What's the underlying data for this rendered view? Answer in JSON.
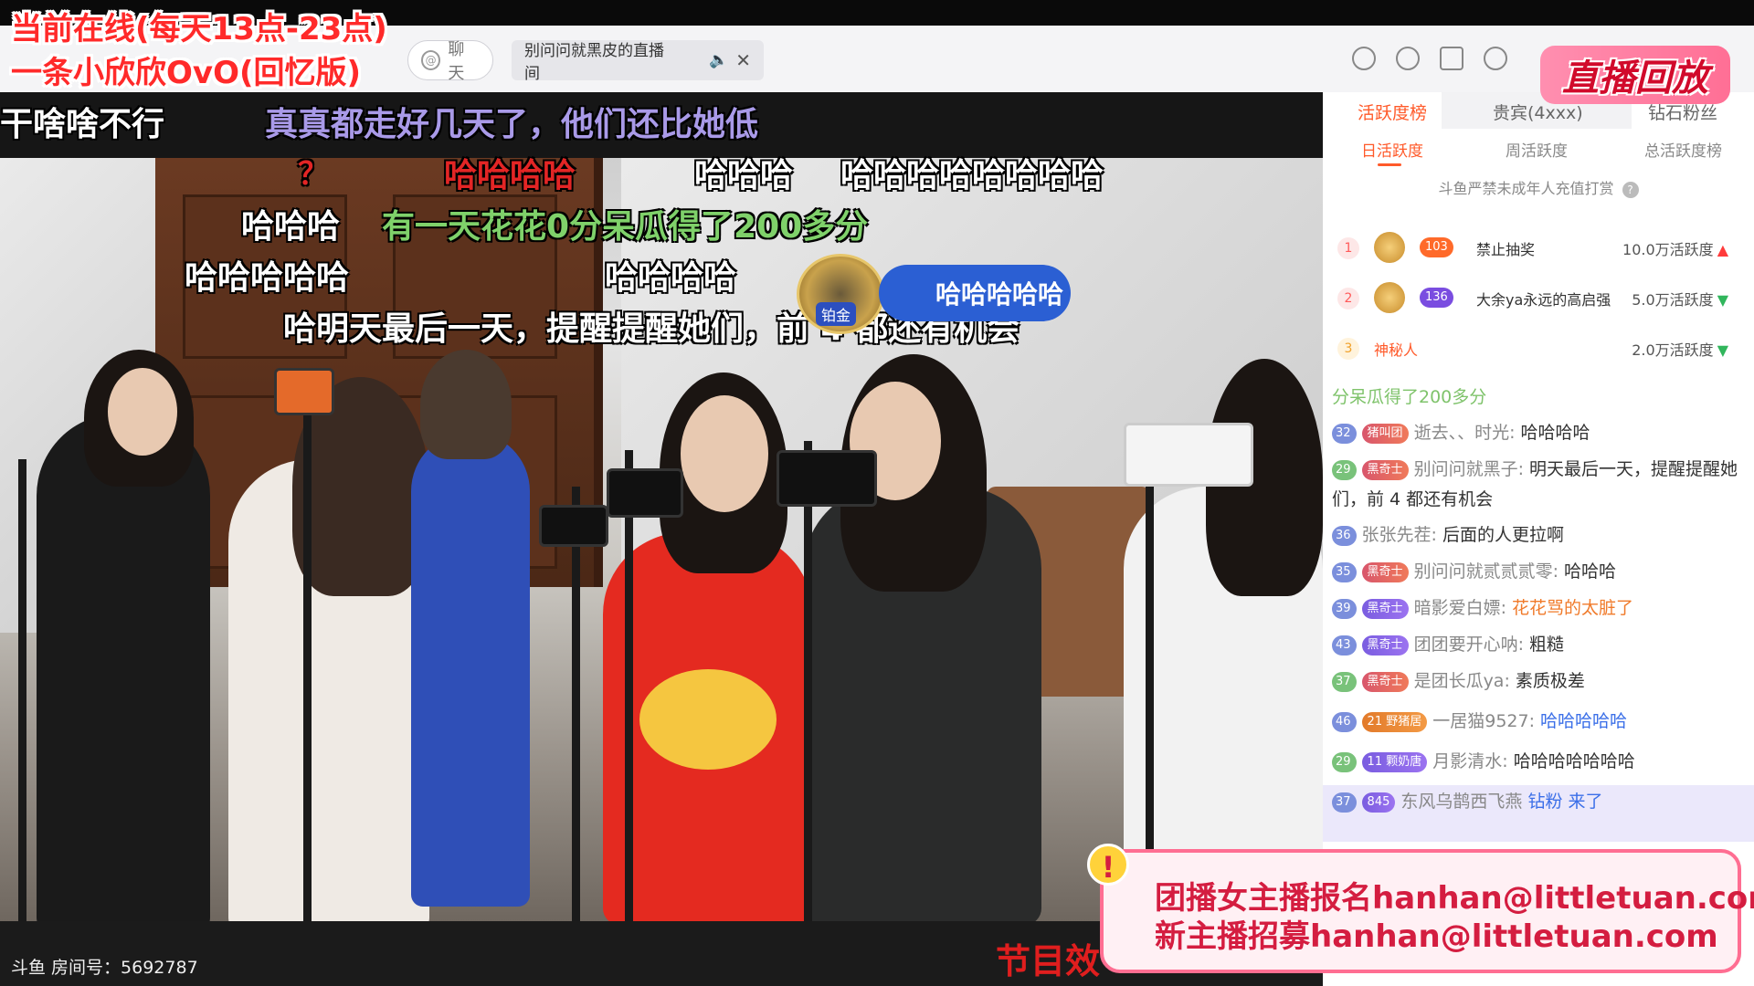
{
  "overlay": {
    "title_line1": "当前在线(每天13点-23点)",
    "title_line2": "一条小欣欣OvO(回忆版)"
  },
  "tabs": {
    "chat_label": "聊天",
    "room_label": "别问问就黑皮的直播间"
  },
  "replay_badge": "直播回放",
  "danmaku": [
    {
      "text": "干啥啥不行",
      "color": "white"
    },
    {
      "text": "真真都走好几天了，他们还比她低",
      "color": "mixed"
    },
    {
      "text": "？",
      "color": "red"
    },
    {
      "text": "哈哈哈哈",
      "color": "red"
    },
    {
      "text": "哈哈哈",
      "color": "white"
    },
    {
      "text": "哈哈哈哈哈哈哈哈",
      "color": "white"
    },
    {
      "text": "哈哈哈",
      "color": "white"
    },
    {
      "text": "有一天花花0分呆瓜得了200多分",
      "color": "green"
    },
    {
      "text": "哈哈哈哈哈",
      "color": "white"
    },
    {
      "text": "哈哈哈哈",
      "color": "white"
    },
    {
      "text": "哈明天最后一天，提醒提醒她们，前 4 都还有机会",
      "color": "white"
    }
  ],
  "vip": {
    "text": "哈哈哈哈哈",
    "badge": "铂金"
  },
  "bottom": {
    "room_number": "斗鱼 房间号：5692787",
    "program_msg": "节目效"
  },
  "rank_tabs": [
    "活跃度榜",
    "贵宾(4xxx)",
    "钻石粉丝"
  ],
  "rank_subtabs": [
    "日活跃度",
    "周活跃度",
    "总活跃度榜"
  ],
  "notice": "斗鱼严禁未成年人充值打赏",
  "ranking": [
    {
      "no": "1",
      "level": "103",
      "name": "禁止抽奖",
      "score": "10.0万活跃度",
      "trend": "up"
    },
    {
      "no": "2",
      "level": "136",
      "name": "大余ya永远的高启强",
      "score": "5.0万活跃度",
      "trend": "down"
    },
    {
      "no": "3",
      "level": "",
      "name": "神秘人",
      "score": "2.0万活跃度",
      "trend": "down"
    }
  ],
  "chat_top": "分呆瓜得了200多分",
  "chat": [
    {
      "lv": "32",
      "fan": "猪叫团",
      "user": "逝去、、时光:",
      "msg": "哈哈哈哈",
      "msg_color": "normal"
    },
    {
      "lv": "29",
      "fan": "黑奇士",
      "user": "别问问就黑子:",
      "msg": "明天最后一天，提醒提醒她们，前 4 都还有机会",
      "msg_color": "normal"
    },
    {
      "lv": "36",
      "fan": "",
      "user": "张张先茬:",
      "msg": "后面的人更拉啊",
      "msg_color": "normal"
    },
    {
      "lv": "35",
      "fan": "黑奇士",
      "user": "别问问就贰贰贰零:",
      "msg": "哈哈哈",
      "msg_color": "normal"
    },
    {
      "lv": "39",
      "fan": "黑奇士",
      "user": "暗影爱白嫖:",
      "msg": "花花骂的太脏了",
      "msg_color": "orange"
    },
    {
      "lv": "43",
      "fan": "黑奇士",
      "user": "团团要开心呐:",
      "msg": "粗糙",
      "msg_color": "normal"
    },
    {
      "lv": "37",
      "fan": "黑奇士",
      "user": "是团长瓜ya:",
      "msg": "素质极差",
      "msg_color": "normal"
    },
    {
      "lv": "46",
      "fan": "21 野猪居",
      "user": "一居猫9527:",
      "msg": "哈哈哈哈哈",
      "msg_color": "blue"
    },
    {
      "lv": "29",
      "fan": "11 颗奶唐",
      "user": "月影清水:",
      "msg": "哈哈哈哈哈哈哈",
      "msg_color": "normal"
    },
    {
      "lv": "37",
      "fan": "845",
      "user": "东风乌鹊西飞燕",
      "msg": "钻粉 来了",
      "msg_color": "normal"
    }
  ],
  "banner": {
    "line1": "团播女主播报名hanhan@littletuan.com",
    "line2": "新主播招募hanhan@littletuan.com"
  }
}
